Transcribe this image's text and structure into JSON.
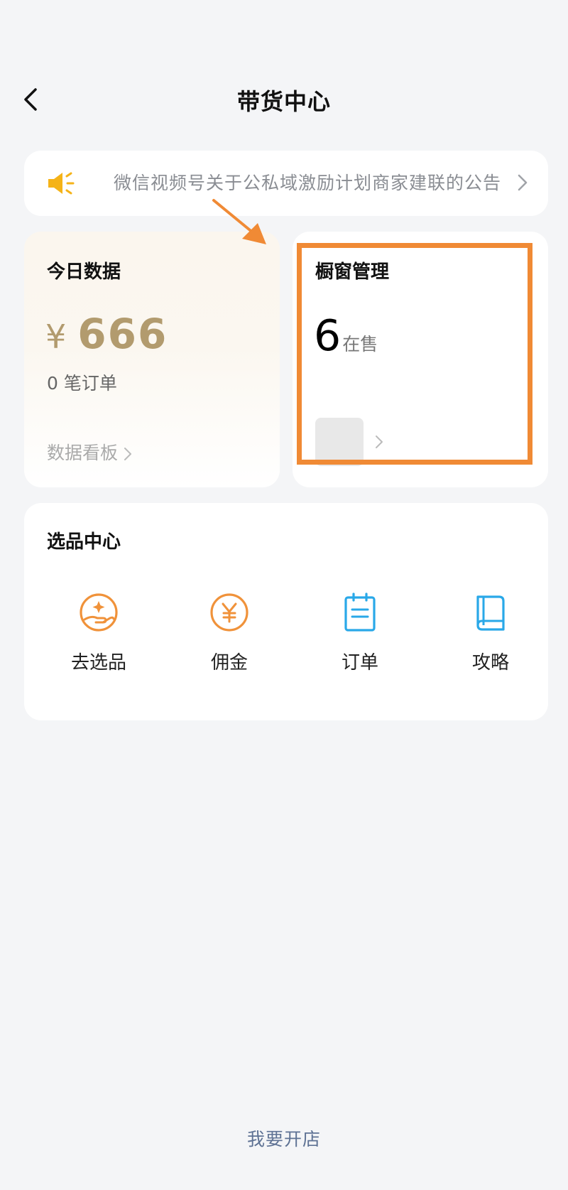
{
  "header": {
    "title": "带货中心"
  },
  "notice": {
    "text": "微信视频号关于公私域激励计划商家建联的公告"
  },
  "data_card": {
    "title": "今日数据",
    "currency": "¥",
    "amount": "666",
    "orders": "0 笔订单",
    "dashboard_link": "数据看板"
  },
  "window_card": {
    "title": "橱窗管理",
    "count": "6",
    "count_label": "在售"
  },
  "select_center": {
    "title": "选品中心",
    "tools": [
      {
        "label": "去选品",
        "icon": "hand-sparkle-icon"
      },
      {
        "label": "佣金",
        "icon": "yen-coin-icon"
      },
      {
        "label": "订单",
        "icon": "clipboard-icon"
      },
      {
        "label": "攻略",
        "icon": "book-icon"
      }
    ]
  },
  "footer": {
    "open_shop": "我要开店"
  },
  "colors": {
    "background": "#f4f5f7",
    "money": "#b29b6e",
    "highlight": "#f08a35",
    "icon_orange": "#f0923a",
    "icon_blue": "#29a8e8",
    "link_blue": "#5e7294",
    "speaker_yellow": "#f5b318"
  }
}
